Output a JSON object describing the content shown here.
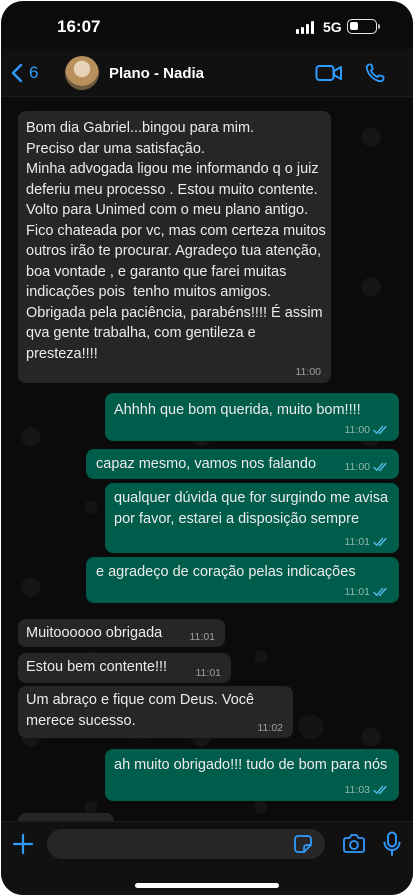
{
  "status_bar": {
    "time": "16:07",
    "network": "5G"
  },
  "header": {
    "back_count": "6",
    "contact_name": "Plano - Nadia"
  },
  "messages": [
    {
      "direction": "in",
      "text": "Bom dia Gabriel...bingou para mim.\nPreciso dar uma satisfação.\nMinha advogada ligou me informando q o juiz deferiu meu processo . Estou muito contente. Volto para Unimed com o meu plano antigo.  Fico chateada por vc, mas com certeza muitos outros irão te procurar. Agradeço tua atenção, boa vontade , e garanto que farei muitas indicações pois  tenho muitos amigos. Obrigada pela paciência, parabéns!!!! É assim qva gente trabalha, com gentileza e presteza!!!!",
      "time": "11:00"
    },
    {
      "direction": "out",
      "text": "Ahhhh que bom querida, muito bom!!!!",
      "time": "11:00",
      "status": "read"
    },
    {
      "direction": "out",
      "text": "capaz mesmo, vamos nos falando",
      "time": "11:00",
      "status": "read"
    },
    {
      "direction": "out",
      "text": "qualquer dúvida que for surgindo me avisa por favor, estarei a disposição sempre",
      "time": "11:01",
      "status": "read"
    },
    {
      "direction": "out",
      "text": "e agradeço de coração pelas indicações",
      "time": "11:01",
      "status": "read"
    },
    {
      "direction": "in",
      "text": "Muitoooooo obrigada",
      "time": "11:01"
    },
    {
      "direction": "in",
      "text": "Estou bem contente!!!",
      "time": "11:01"
    },
    {
      "direction": "in",
      "text": "Um abraço e fique com Deus. Você merece sucesso.",
      "time": "11:02"
    },
    {
      "direction": "out",
      "text": "ah muito obrigado!!! tudo de bom para nós",
      "time": "11:03",
      "status": "read"
    }
  ],
  "input": {
    "placeholder": ""
  },
  "colors": {
    "background": "#0b0b0b",
    "incoming_bubble": "#262626",
    "outgoing_bubble": "#005c4b",
    "accent_blue": "#2f9bff",
    "read_tick": "#53bdeb"
  },
  "icons": [
    "back-chevron-icon",
    "video-call-icon",
    "phone-icon",
    "plus-icon",
    "sticker-icon",
    "camera-icon",
    "microphone-icon",
    "double-check-icon"
  ]
}
